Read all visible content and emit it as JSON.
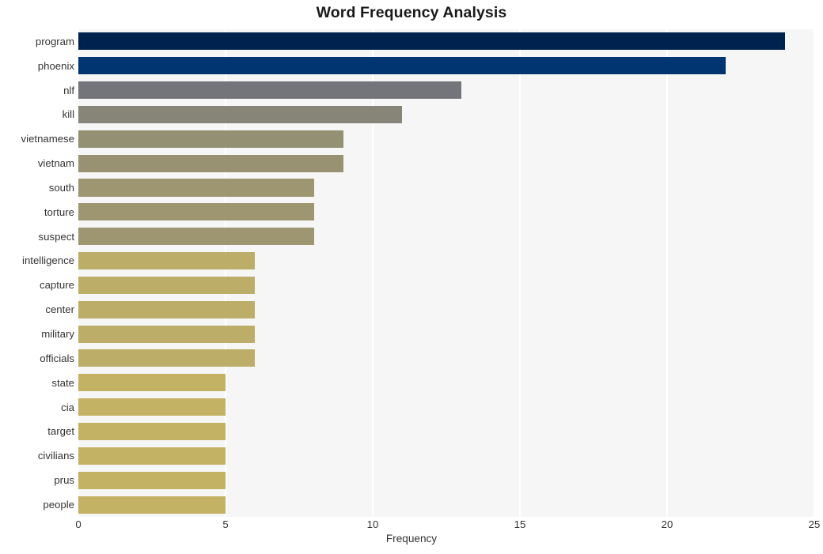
{
  "chart_data": {
    "type": "bar",
    "orientation": "horizontal",
    "title": "Word Frequency Analysis",
    "xlabel": "Frequency",
    "ylabel": "",
    "xlim": [
      0,
      25
    ],
    "ylim": [
      0,
      20
    ],
    "xticks": [
      0,
      5,
      10,
      15,
      20,
      25
    ],
    "xticklabels": [
      "0",
      "5",
      "10",
      "15",
      "20",
      "25"
    ],
    "grid": "vertical-white",
    "legend": "none",
    "plot_background": "#f6f6f6",
    "figure_background": "#ffffff",
    "categories": [
      "program",
      "phoenix",
      "nlf",
      "kill",
      "vietnamese",
      "vietnam",
      "south",
      "torture",
      "suspect",
      "intelligence",
      "capture",
      "center",
      "military",
      "officials",
      "state",
      "cia",
      "target",
      "civilians",
      "prus",
      "people"
    ],
    "values": [
      24,
      22,
      13,
      11,
      9,
      9,
      8,
      8,
      8,
      6,
      6,
      6,
      6,
      6,
      5,
      5,
      5,
      5,
      5,
      5
    ],
    "bar_colors": [
      "#00224e",
      "#003571",
      "#74757a",
      "#868577",
      "#949074",
      "#989272",
      "#9d9670",
      "#9d9670",
      "#9d9670",
      "#bcae68",
      "#bcae68",
      "#bcae68",
      "#bcae68",
      "#bcae68",
      "#c3b264",
      "#c3b264",
      "#c3b264",
      "#c3b264",
      "#c3b264",
      "#c3b264"
    ]
  }
}
